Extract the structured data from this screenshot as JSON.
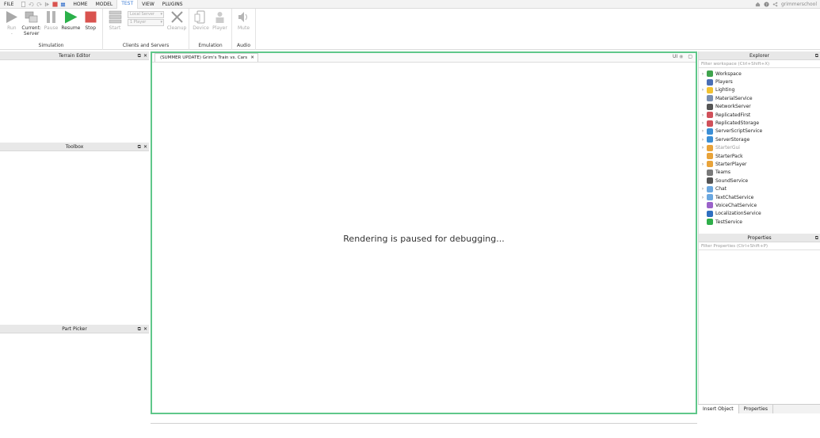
{
  "menubar": {
    "file": "FILE",
    "tabs": [
      "HOME",
      "MODEL",
      "TEST",
      "VIEW",
      "PLUGINS"
    ],
    "active_tab": "TEST",
    "username": "grimmerschool"
  },
  "ribbon": {
    "simulation": {
      "label": "Simulation",
      "run": "Run",
      "run_sub": "-",
      "current": "Current:",
      "current_sub": "Server",
      "pause": "Pause",
      "resume": "Resume",
      "stop": "Stop"
    },
    "clients": {
      "label": "Clients and Servers",
      "start": "Start",
      "local_server": "Local Server",
      "players": "1 Player",
      "cleanup": "Cleanup"
    },
    "emulation": {
      "label": "Emulation",
      "device": "Device",
      "player": "Player"
    },
    "audio": {
      "label": "Audio",
      "mute": "Mute"
    }
  },
  "left_panels": {
    "terrain_editor": "Terrain Editor",
    "toolbox": "Toolbox",
    "part_picker": "Part Picker"
  },
  "center": {
    "tab_title": "(SUMMER UPDATE) Grim's Train vs. Cars",
    "ui_label": "UI",
    "paused_message": "Rendering is paused for debugging..."
  },
  "explorer": {
    "title": "Explorer",
    "filter_placeholder": "Filter workspace (Ctrl+Shift+X)",
    "items": [
      {
        "label": "Workspace",
        "expandable": true,
        "icon": "globe-icon",
        "color": "#3fa34d"
      },
      {
        "label": "Players",
        "expandable": false,
        "icon": "players-icon",
        "color": "#4a6fb5"
      },
      {
        "label": "Lighting",
        "expandable": true,
        "icon": "bulb-icon",
        "color": "#f2c230"
      },
      {
        "label": "MaterialService",
        "expandable": false,
        "icon": "material-icon",
        "color": "#7a8fb0"
      },
      {
        "label": "NetworkServer",
        "expandable": false,
        "icon": "network-icon",
        "color": "#555555"
      },
      {
        "label": "ReplicatedFirst",
        "expandable": true,
        "icon": "replicated-first-icon",
        "color": "#d0505a"
      },
      {
        "label": "ReplicatedStorage",
        "expandable": true,
        "icon": "replicated-storage-icon",
        "color": "#d0505a"
      },
      {
        "label": "ServerScriptService",
        "expandable": true,
        "icon": "server-script-icon",
        "color": "#3b8fd6"
      },
      {
        "label": "ServerStorage",
        "expandable": true,
        "icon": "server-storage-icon",
        "color": "#3b8fd6"
      },
      {
        "label": "StarterGui",
        "expandable": true,
        "icon": "starter-gui-icon",
        "color": "#e8a33a",
        "dim": true
      },
      {
        "label": "StarterPack",
        "expandable": false,
        "icon": "starter-pack-icon",
        "color": "#e8a33a"
      },
      {
        "label": "StarterPlayer",
        "expandable": true,
        "icon": "starter-player-icon",
        "color": "#e8a33a"
      },
      {
        "label": "Teams",
        "expandable": false,
        "icon": "teams-icon",
        "color": "#7a7a7a"
      },
      {
        "label": "SoundService",
        "expandable": false,
        "icon": "sound-icon",
        "color": "#555555"
      },
      {
        "label": "Chat",
        "expandable": true,
        "icon": "chat-icon",
        "color": "#6aa7e0"
      },
      {
        "label": "TextChatService",
        "expandable": true,
        "icon": "text-chat-icon",
        "color": "#6aa7e0"
      },
      {
        "label": "VoiceChatService",
        "expandable": false,
        "icon": "voice-chat-icon",
        "color": "#9a62c9"
      },
      {
        "label": "LocalizationService",
        "expandable": false,
        "icon": "localization-icon",
        "color": "#2f6fc0"
      },
      {
        "label": "TestService",
        "expandable": false,
        "icon": "test-icon",
        "color": "#2fae4a"
      }
    ]
  },
  "properties": {
    "title": "Properties",
    "filter_placeholder": "Filter Properties (Ctrl+Shift+P)"
  },
  "bottom_tabs": [
    "Insert Object",
    "Properties"
  ],
  "colors": {
    "accent_green": "#5fc78a",
    "resume_green": "#2bb04a",
    "stop_red": "#d9534f",
    "active_tab_blue": "#3a7bd5"
  }
}
